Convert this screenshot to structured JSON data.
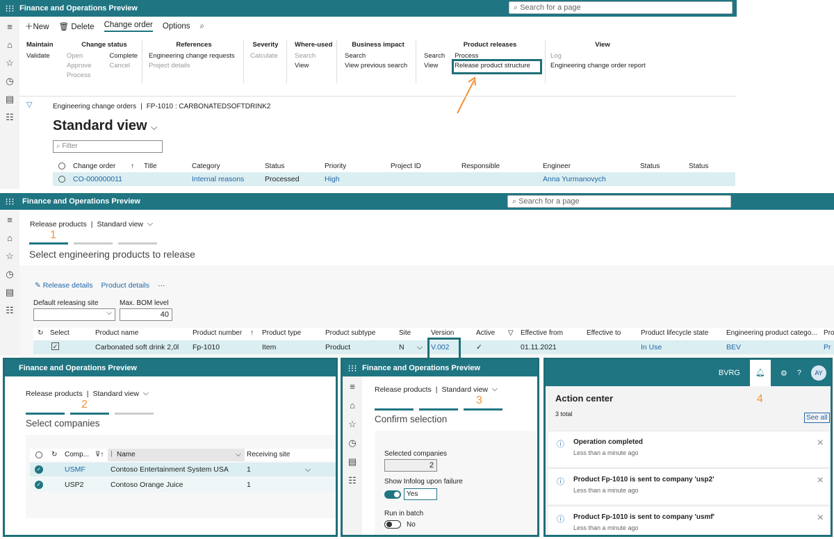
{
  "app_title": "Finance and Operations Preview",
  "search_placeholder": "Search for a page",
  "top": {
    "actions": {
      "new": "New",
      "delete": "Delete",
      "change_order": "Change order",
      "options": "Options"
    },
    "groups": {
      "maintain": {
        "h": "Maintain",
        "a": "Validate"
      },
      "change_status": {
        "h": "Change status",
        "open": "Open",
        "approve": "Approve",
        "process": "Process",
        "complete": "Complete",
        "cancel": "Cancel"
      },
      "references": {
        "h": "References",
        "a": "Engineering change requests",
        "b": "Project details"
      },
      "severity": {
        "h": "Severity",
        "a": "Calculate"
      },
      "where_used": {
        "h": "Where-used",
        "a": "Search",
        "b": "View"
      },
      "business_impact": {
        "h": "Business impact",
        "a": "Search",
        "b": "View previous search"
      },
      "product_releases": {
        "h": "Product releases",
        "s": "Search",
        "v": "View",
        "p": "Process",
        "r": "Release product structure"
      },
      "view": {
        "h": "View",
        "a": "Log",
        "b": "Engineering change order report"
      }
    },
    "breadcrumb": "Engineering change orders",
    "breadcrumb_sep": "|",
    "record": "FP-1010 : CARBONATEDSOFTDRINK2",
    "view_title": "Standard view",
    "filter_placeholder": "Filter",
    "columns": [
      "Change order",
      "Title",
      "Category",
      "Status",
      "Priority",
      "Project ID",
      "Responsible",
      "Engineer",
      "Status",
      "Status"
    ],
    "row": {
      "change_order": "CO-000000011",
      "category": "Internal reasons",
      "status": "Processed",
      "priority": "High",
      "engineer": "Anna Yurmanovych"
    }
  },
  "release": {
    "breadcrumb": "Release products",
    "view": "Standard view",
    "step": "1",
    "step_title": "Select engineering products to release",
    "actions": {
      "release_details": "Release details",
      "product_details": "Product details",
      "more": "···"
    },
    "site_label": "Default releasing site",
    "bom_label": "Max. BOM level",
    "bom_value": "40",
    "columns": [
      "Select",
      "Product name",
      "Product number",
      "Product type",
      "Product subtype",
      "Site",
      "Version",
      "Active",
      "Effective from",
      "Effective to",
      "Product lifecycle state",
      "Engineering product catego...",
      "Pro"
    ],
    "row": {
      "name": "Carbonated soft drink 2,0l",
      "number": "Fp-1010",
      "type": "Item",
      "subtype": "Product",
      "site": "N",
      "version": "V.002",
      "active": "✓",
      "effective_from": "01.11.2021",
      "lifecycle": "In Use",
      "category": "BEV",
      "pro": "Pr"
    }
  },
  "step2": {
    "breadcrumb": "Release products",
    "view": "Standard view",
    "step": "2",
    "title": "Select companies",
    "columns": [
      "Comp...",
      "Name",
      "Receiving site"
    ],
    "rows": [
      {
        "company": "USMF",
        "name": "Contoso Entertainment System USA",
        "site": "1"
      },
      {
        "company": "USP2",
        "name": "Contoso Orange Juice",
        "site": "1"
      }
    ]
  },
  "step3": {
    "breadcrumb": "Release products",
    "view": "Standard view",
    "step": "3",
    "title": "Confirm selection",
    "selected_label": "Selected companies",
    "selected_value": "2",
    "infolog_label": "Show Infolog upon failure",
    "infolog_value": "Yes",
    "batch_label": "Run in batch",
    "batch_value": "No"
  },
  "step4": {
    "company": "BVRG",
    "avatar": "AY",
    "step": "4",
    "title": "Action center",
    "total": "3 total",
    "see_all": "See all",
    "items": [
      {
        "title": "Operation completed",
        "time": "Less than a minute ago"
      },
      {
        "title": "Product Fp-1010 is sent to company 'usp2'",
        "time": "Less than a minute ago"
      },
      {
        "title": "Product Fp-1010 is sent to company 'usmf'",
        "time": "Less than a minute ago"
      }
    ]
  }
}
